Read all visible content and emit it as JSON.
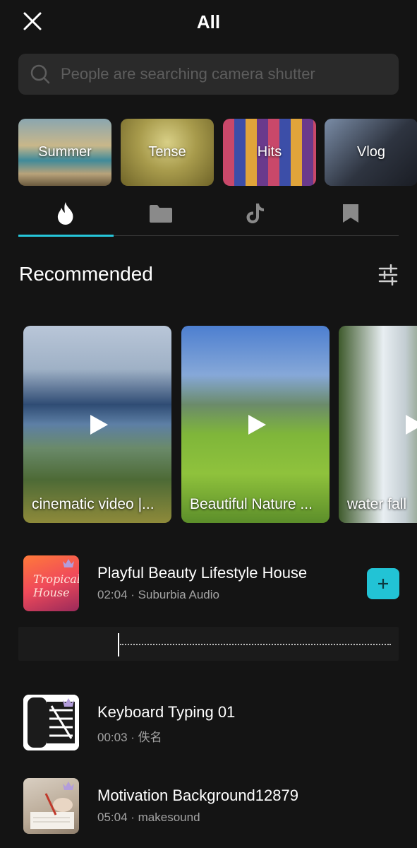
{
  "header": {
    "title": "All"
  },
  "search": {
    "placeholder": "People are searching camera shutter"
  },
  "categories": [
    {
      "label": "Summer"
    },
    {
      "label": "Tense"
    },
    {
      "label": "Hits"
    },
    {
      "label": "Vlog"
    }
  ],
  "tabs": [
    {
      "icon": "flame-icon",
      "active": true
    },
    {
      "icon": "folder-icon",
      "active": false
    },
    {
      "icon": "tiktok-icon",
      "active": false
    },
    {
      "icon": "bookmark-icon",
      "active": false
    }
  ],
  "recommended": {
    "title": "Recommended",
    "videos": [
      {
        "label": "cinematic video |..."
      },
      {
        "label": "Beautiful Nature ..."
      },
      {
        "label": "water fall"
      }
    ]
  },
  "tracks": [
    {
      "title": "Playful Beauty Lifestyle House",
      "meta": "02:04 · Suburbia Audio",
      "thumb_text": "Tropical House"
    },
    {
      "title": "Keyboard Typing 01",
      "meta": "00:03 · 佚名"
    },
    {
      "title": "Motivation Background12879",
      "meta": "05:04 · makesound"
    }
  ],
  "colors": {
    "accent": "#22c3d5",
    "background": "#141414",
    "search_bg": "#2a2a2a",
    "premium": "#b39ddb"
  }
}
